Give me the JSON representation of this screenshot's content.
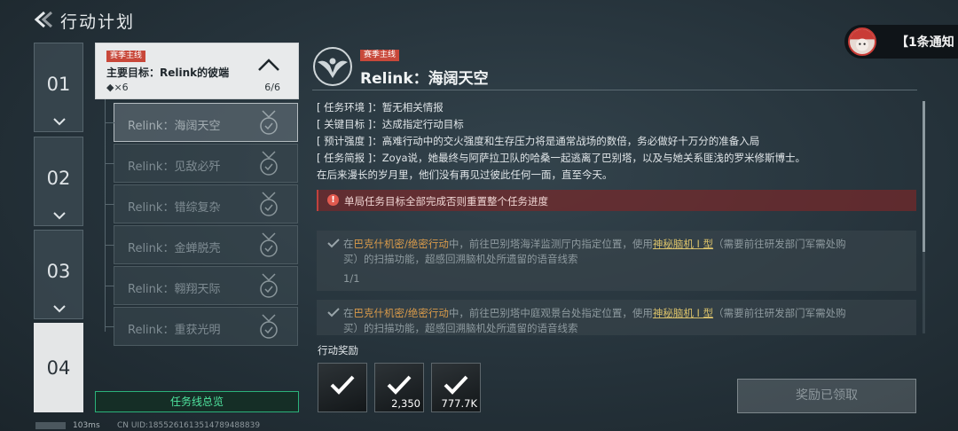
{
  "header": {
    "title": "行动计划"
  },
  "chapters": [
    {
      "label": "01"
    },
    {
      "label": "02"
    },
    {
      "label": "03"
    },
    {
      "label": "04"
    }
  ],
  "goal": {
    "tag": "赛季主线",
    "title": "主要目标：Relink的彼端",
    "reward": "◆×6",
    "progress": "6/6"
  },
  "subtasks": [
    {
      "label": "Relink：海阔天空"
    },
    {
      "label": "Relink：见敌必歼"
    },
    {
      "label": "Relink：错综复杂"
    },
    {
      "label": "Relink：金蝉脱壳"
    },
    {
      "label": "Relink：翱翔天际"
    },
    {
      "label": "Relink：重获光明"
    }
  ],
  "overview_button": "任务线总览",
  "detail": {
    "tag": "赛季主线",
    "title": "Relink：海阔天空",
    "info": [
      "[ 任务环境 ]：暂无相关情报",
      "[ 关键目标 ]：达成指定行动目标",
      "[ 预计强度 ]：高难行动中的交火强度和生存压力将是通常战场的数倍，务必做好十万分的准备入局",
      "[ 任务简报 ]：Zoya说，她最终与阿萨拉卫队的哈桑一起逃离了巴别塔，以及与她关系匪浅的罗米修斯博士。",
      "在后来漫长的岁月里，他们没有再见过彼此任何一面，直至今天。"
    ],
    "warning": "单局任务目标全部完成否则重置整个任务进度",
    "objectives": [
      {
        "prefix": "在",
        "mode": "巴克什机密/绝密行动",
        "mid": "中，前往巴别塔海洋监测厅内指定位置，使用",
        "item": "神秘脑机 I 型",
        "suffix": "（需要前往研发部门军需处购",
        "line2": "买）的扫描功能，超感回溯脑机处所遗留的语音线索",
        "progress": "1/1"
      },
      {
        "prefix": "在",
        "mode": "巴克什机密/绝密行动",
        "mid": "中，前往巴别塔中庭观景台处指定位置，使用",
        "item": "神秘脑机 I 型",
        "suffix": "（需要前往研发部门军需处购",
        "line2": "买）的扫描功能，超感回溯脑机处所遗留的语音线索"
      }
    ]
  },
  "rewards": {
    "label": "行动奖励",
    "items": [
      {
        "icon": "checkmark-icon",
        "amount": ""
      },
      {
        "icon": "checkmark-icon",
        "amount": "2,350"
      },
      {
        "icon": "checkmark-icon",
        "amount": "777.7K"
      }
    ],
    "claimed_button": "奖励已领取"
  },
  "notification": {
    "text": "【1条通知"
  },
  "footer": {
    "latency": "103ms",
    "uid": "CN UID:1855261613514789488839"
  },
  "colors": {
    "accent_green": "#4fe49f",
    "tag_red": "#c8483a",
    "warning_red": "#c0413d",
    "highlight_orange": "#d89a4a"
  }
}
